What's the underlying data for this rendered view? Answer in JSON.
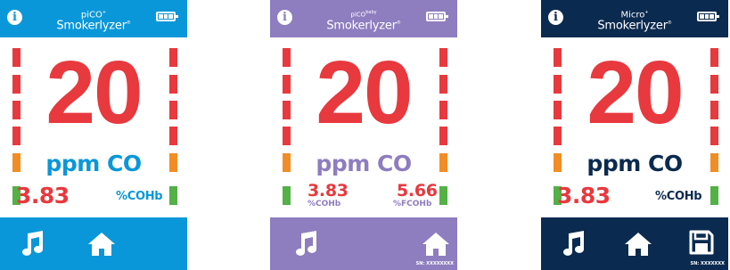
{
  "colors": {
    "pico_blue": "#0a97d9",
    "baby_purple": "#8e7dbf",
    "micro_navy": "#0b2a4f",
    "reading_red": "#e8393e",
    "bar_orange": "#f28d25",
    "bar_green": "#53b146"
  },
  "devices": [
    {
      "brand_top": "piCO",
      "brand_sup": "+",
      "brand_name": "Smokerlyzer",
      "brand_mark": "®",
      "reading": "20",
      "unit": "ppm CO",
      "cohb_value": "3.83",
      "cohb_label": "%COHb",
      "footer_icons": [
        "music-note-icon",
        "home-icon"
      ]
    },
    {
      "brand_top": "piCO",
      "brand_sup": "baby",
      "brand_name": "Smokerlyzer",
      "brand_mark": "®",
      "reading": "20",
      "unit": "ppm CO",
      "cohb_value": "3.83",
      "cohb_label": "%COHb",
      "fcohb_value": "5.66",
      "fcohb_label": "%FCOHb",
      "serial": "SN: XXXXXXXX",
      "footer_icons": [
        "music-note-icon",
        "home-icon"
      ]
    },
    {
      "brand_top": "Micro",
      "brand_sup": "+",
      "brand_name": "Smokerlyzer",
      "brand_mark": "®",
      "reading": "20",
      "unit": "ppm CO",
      "cohb_value": "3.83",
      "cohb_label": "%COHb",
      "serial": "SN: XXXXXXX",
      "footer_icons": [
        "music-note-icon",
        "home-icon",
        "save-icon"
      ]
    }
  ],
  "icons": {
    "info": "i",
    "battery": "battery-full-icon"
  }
}
